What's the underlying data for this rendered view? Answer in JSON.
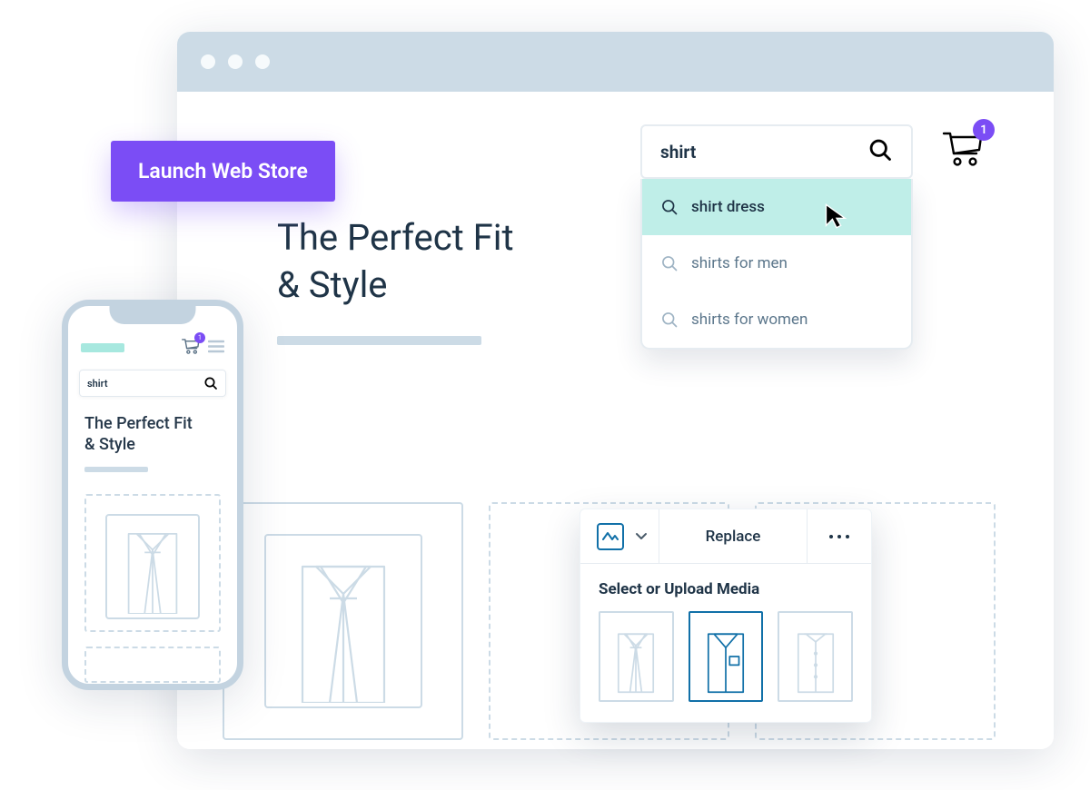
{
  "launch_button_label": "Launch Web Store",
  "desktop": {
    "hero_line1": "The Perfect Fit",
    "hero_line2": "& Style",
    "search": {
      "query": "shirt"
    },
    "search_suggestions": [
      {
        "label": "shirt dress",
        "highlighted": true
      },
      {
        "label": "shirts for men",
        "highlighted": false
      },
      {
        "label": "shirts for women",
        "highlighted": false
      }
    ],
    "cart_count": "1"
  },
  "phone": {
    "search": {
      "query": "shirt"
    },
    "hero_line1": "The Perfect Fit",
    "hero_line2": "& Style",
    "cart_count": "1"
  },
  "media_popup": {
    "replace_label": "Replace",
    "title": "Select or Upload Media"
  }
}
